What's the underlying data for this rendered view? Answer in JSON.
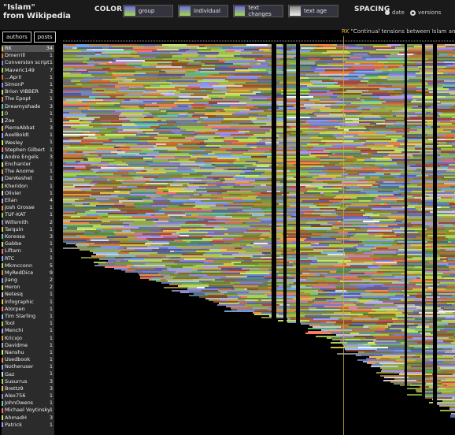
{
  "title": {
    "line1": "\"Islam\"",
    "line2": "from Wikipedia"
  },
  "color": {
    "label": "COLOR",
    "options": [
      "group",
      "individual",
      "text changes",
      "text age"
    ],
    "selected": "group"
  },
  "spacing": {
    "label": "SPACING",
    "options": [
      "date",
      "versions"
    ],
    "selected": "versions"
  },
  "tabs": [
    "authors",
    "posts"
  ],
  "tooltip": {
    "author": "RK",
    "text": "\"Continual tensions between Islam and Juda"
  },
  "authors": [
    {
      "name": "RK",
      "count": "34",
      "color": "#e8c84c"
    },
    {
      "name": "Dmerrill",
      "count": "1",
      "color": "#d08040"
    },
    {
      "name": "Conversion script",
      "count": "1",
      "color": "#8888dd"
    },
    {
      "name": "Maveric149",
      "count": "7",
      "color": "#a8d850"
    },
    {
      "name": "...April",
      "count": "1",
      "color": "#e07030"
    },
    {
      "name": "SimonP",
      "count": "1",
      "color": "#9090ff"
    },
    {
      "name": "Brion VIBBER",
      "count": "3",
      "color": "#c0e070"
    },
    {
      "name": "The Epopt",
      "count": "1",
      "color": "#ff9050"
    },
    {
      "name": "Dreamyshade",
      "count": "3",
      "color": "#70c0c0"
    },
    {
      "name": "0",
      "count": "1",
      "color": "#b8e060"
    },
    {
      "name": "Zoe",
      "count": "1",
      "color": "#d0d0d0"
    },
    {
      "name": "PierreAbbat",
      "count": "3",
      "color": "#e8c84c"
    },
    {
      "name": "AxelBoldt",
      "count": "1",
      "color": "#a0a0ff"
    },
    {
      "name": "Wesley",
      "count": "1",
      "color": "#c8e858"
    },
    {
      "name": "Stephen Gilbert",
      "count": "1",
      "color": "#ff8060"
    },
    {
      "name": "Andre Engels",
      "count": "3",
      "color": "#90c0ff"
    },
    {
      "name": "Enchanter",
      "count": "1",
      "color": "#d0f070"
    },
    {
      "name": "The Anome",
      "count": "1",
      "color": "#e0a040"
    },
    {
      "name": "DanKeshet",
      "count": "1",
      "color": "#b0b0e0"
    },
    {
      "name": "Kheridon",
      "count": "1",
      "color": "#a8d850"
    },
    {
      "name": "Olivier",
      "count": "1",
      "color": "#e0e0e0"
    },
    {
      "name": "Elian",
      "count": "4",
      "color": "#c0a0ff"
    },
    {
      "name": "Josh Grosse",
      "count": "1",
      "color": "#ff9040"
    },
    {
      "name": "TUF-KAT",
      "count": "1",
      "color": "#a8d850"
    },
    {
      "name": "Willsmith",
      "count": "2",
      "color": "#9090d0"
    },
    {
      "name": "Tarquin",
      "count": "1",
      "color": "#e8c84c"
    },
    {
      "name": "Koreosa",
      "count": "3",
      "color": "#70d0a0"
    },
    {
      "name": "Gabbe",
      "count": "1",
      "color": "#d8e870"
    },
    {
      "name": "Liftarn",
      "count": "1",
      "color": "#ff7070"
    },
    {
      "name": "RTC",
      "count": "1",
      "color": "#80b0ff"
    },
    {
      "name": "Mkmcconn",
      "count": "5",
      "color": "#b8e060"
    },
    {
      "name": "MyRedDice",
      "count": "9",
      "color": "#e09050"
    },
    {
      "name": "Jiang",
      "count": "2",
      "color": "#a0a0ff"
    },
    {
      "name": "Heron",
      "count": "2",
      "color": "#c8e858"
    },
    {
      "name": "Netesq",
      "count": "1",
      "color": "#d0d0d0"
    },
    {
      "name": "Infographic",
      "count": "1",
      "color": "#e8c84c"
    },
    {
      "name": "Atorpen",
      "count": "1",
      "color": "#ff8060"
    },
    {
      "name": "Tim Starling",
      "count": "1",
      "color": "#90c0ff"
    },
    {
      "name": "Tool",
      "count": "1",
      "color": "#a8d850"
    },
    {
      "name": "Menchi",
      "count": "1",
      "color": "#c0a0ff"
    },
    {
      "name": "Kricxjo",
      "count": "1",
      "color": "#e0a040"
    },
    {
      "name": "Davidme",
      "count": "1",
      "color": "#b0b0e0"
    },
    {
      "name": "Nanshu",
      "count": "1",
      "color": "#d0f070"
    },
    {
      "name": "Usedbook",
      "count": "1",
      "color": "#ff9040"
    },
    {
      "name": "Notheruser",
      "count": "1",
      "color": "#80b0ff"
    },
    {
      "name": "Gaz",
      "count": "1",
      "color": "#e0e0e0"
    },
    {
      "name": "Susurrus",
      "count": "3",
      "color": "#a8d850"
    },
    {
      "name": "Brettz9",
      "count": "3",
      "color": "#e8c84c"
    },
    {
      "name": "Alex756",
      "count": "1",
      "color": "#9090d0"
    },
    {
      "name": "JohnOwens",
      "count": "1",
      "color": "#70d0a0"
    },
    {
      "name": "Michael Voytinsky",
      "count": "1",
      "color": "#ff7070"
    },
    {
      "name": "AhmadH",
      "count": "3",
      "color": "#c8e858"
    },
    {
      "name": "Patrick",
      "count": "1",
      "color": "#a0a0ff"
    }
  ]
}
